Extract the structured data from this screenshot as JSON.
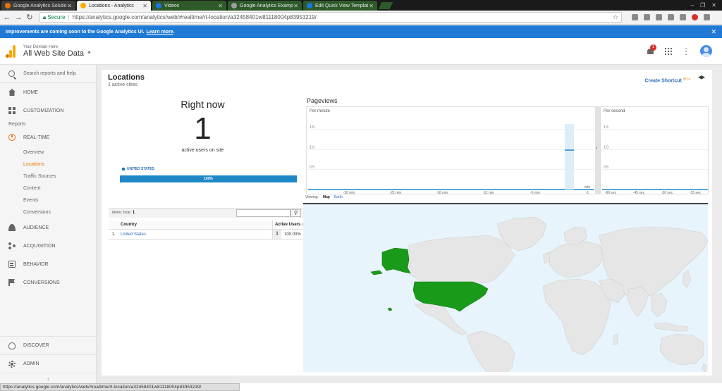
{
  "browser": {
    "tabs": [
      {
        "label": "Google Analytics Solutio",
        "color": "#e8710a"
      },
      {
        "label": "Locations - Analytics",
        "color": "#f9ab00"
      },
      {
        "label": "Videos",
        "color": "#1a73e8"
      },
      {
        "label": "Google Analytics Examp",
        "color": "#9e9e9e"
      },
      {
        "label": "Edit Quick View Templat",
        "color": "#1a73e8"
      }
    ],
    "secure_label": "Secure",
    "url": "https://analytics.google.com/analytics/web/#realtime/rt-location/a32458401w81118004p83953219/",
    "status_url": "https://analytics.google.com/analytics/web/#realtime/rt-location/a32458401w81118004p83953219/"
  },
  "banner": {
    "text": "Improvements are coming soon to the Google Analytics UI.",
    "link": "Learn more",
    "suffix": ".",
    "color": "#1f7ad5"
  },
  "header": {
    "domain": "Your Domain Here",
    "view": "All Web Site Data",
    "notification_count": "1"
  },
  "sidebar": {
    "search_placeholder": "Search reports and help",
    "home": "HOME",
    "customization": "CUSTOMIZATION",
    "reports_label": "Reports",
    "realtime": "REAL-TIME",
    "realtime_items": [
      "Overview",
      "Locations",
      "Traffic Sources",
      "Content",
      "Events",
      "Conversions"
    ],
    "audience": "AUDIENCE",
    "acquisition": "ACQUISITION",
    "behavior": "BEHAVIOR",
    "conversions": "CONVERSIONS",
    "discover": "DISCOVER",
    "admin": "ADMIN",
    "accent_color": "#e8710a"
  },
  "report": {
    "title": "Locations",
    "subtitle": "1 active cities",
    "create_shortcut": "Create Shortcut",
    "beta": "BETA"
  },
  "right_now": {
    "title": "Right now",
    "count": "1",
    "caption": "active users on site",
    "country": "UNITED STATES",
    "percent_label": "100%",
    "percent": 100
  },
  "pageviews": {
    "title": "Pageviews",
    "per_minute_label": "Per minute",
    "per_second_label": "Per second",
    "arrow": "›"
  },
  "chart_data": [
    {
      "type": "bar",
      "title": "Per minute",
      "ylim": [
        0,
        1.5
      ],
      "yticks": [
        "1.5",
        "1.0",
        "0.5"
      ],
      "xticks": [
        "-26 min",
        "-21 min",
        "-16 min",
        "-11 min",
        "-6 min",
        "-1"
      ],
      "xtick_top": "min",
      "categories": [
        "-2 min"
      ],
      "values": [
        1
      ],
      "grid": true,
      "color": "#1e88c7"
    },
    {
      "type": "bar",
      "title": "Per second",
      "ylim": [
        0,
        1.5
      ],
      "yticks": [
        "1.5",
        "1.0",
        "0.5"
      ],
      "xticks": [
        "-60 sec",
        "-45 sec",
        "-30 sec",
        "-15 sec"
      ],
      "values": [],
      "grid": true,
      "color": "#1e88c7"
    }
  ],
  "table": {
    "metric_total_label": "Metric Total:",
    "metric_total_value": "1",
    "col_country": "Country",
    "col_active": "Active Users",
    "rows": [
      {
        "index": "1.",
        "country": "United States",
        "users": "1",
        "percent": "100.00%"
      }
    ]
  },
  "map": {
    "viewing_label": "Viewing:",
    "map_option": "Map",
    "earth_option": "Earth",
    "highlight_color": "#1a9a1a",
    "land_color": "#e6e6e6",
    "water_color": "#e8f4fb"
  }
}
